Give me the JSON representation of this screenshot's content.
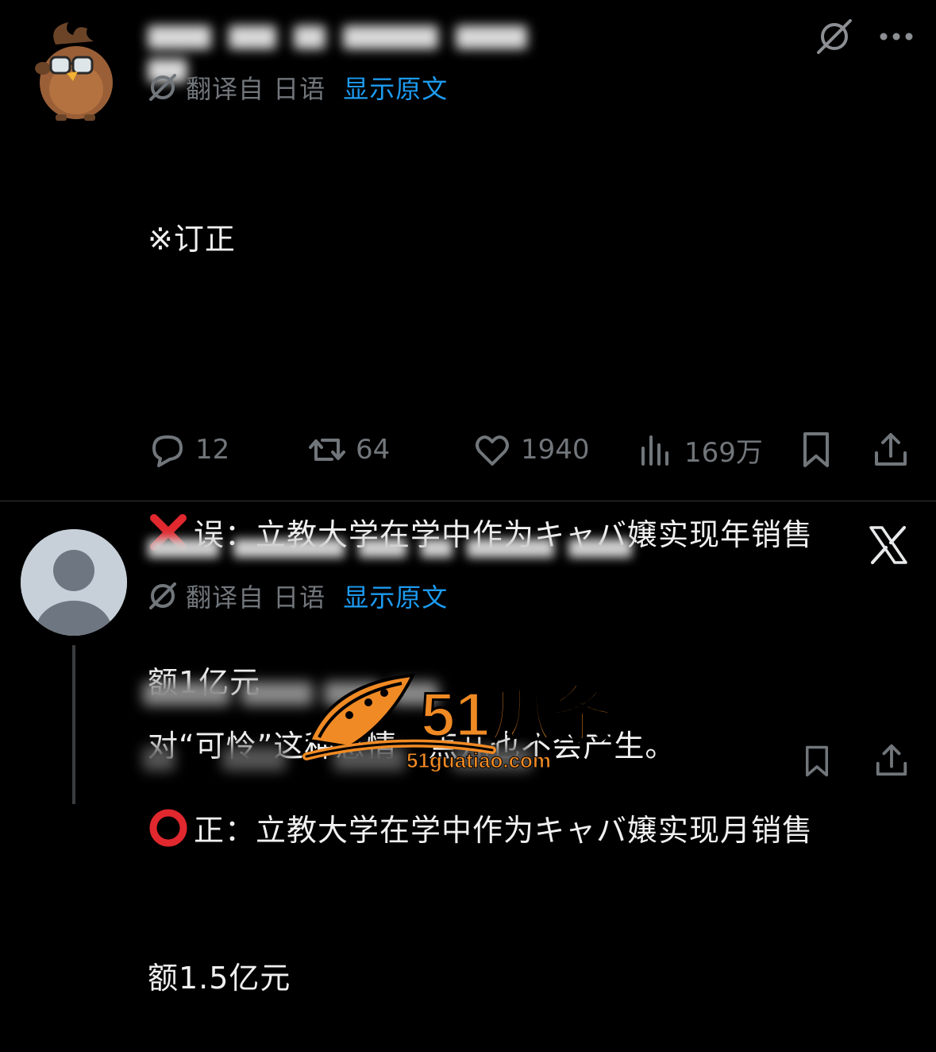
{
  "post1": {
    "translate": {
      "from_label": "翻译自 日语",
      "show_original": "显示原文"
    },
    "lines": [
      "※订正",
      "",
      "误：立教大学在学中作为キャバ嬢实现年销售",
      "额1亿元",
      "正：立教大学在学中作为キャバ嬢实现月销售",
      "额1.5亿元"
    ],
    "actions": {
      "replies": "12",
      "reposts": "64",
      "likes": "1940",
      "views": "169万"
    }
  },
  "post2": {
    "translate": {
      "from_label": "翻译自 日语",
      "show_original": "显示原文"
    },
    "text": "对“可怜”这种感情一点儿也不会产生。"
  },
  "watermark": {
    "brand": "51瓜条",
    "url": "51guatiao.com"
  },
  "icons": {
    "grok": "grok-slash-icon",
    "more": "more-dots-icon",
    "reply": "reply-bubble-icon",
    "repost": "repost-icon",
    "like": "heart-icon",
    "views": "views-bars-icon",
    "bookmark": "bookmark-icon",
    "share": "share-icon",
    "x": "x-logo-icon",
    "translate": "translate-icon"
  },
  "colors": {
    "background": "#000000",
    "link_blue": "#1d9bf0",
    "muted": "#71767b",
    "text": "#e7e9ea",
    "cross_red": "#e0282e",
    "watermark_orange": "#f08a24"
  }
}
